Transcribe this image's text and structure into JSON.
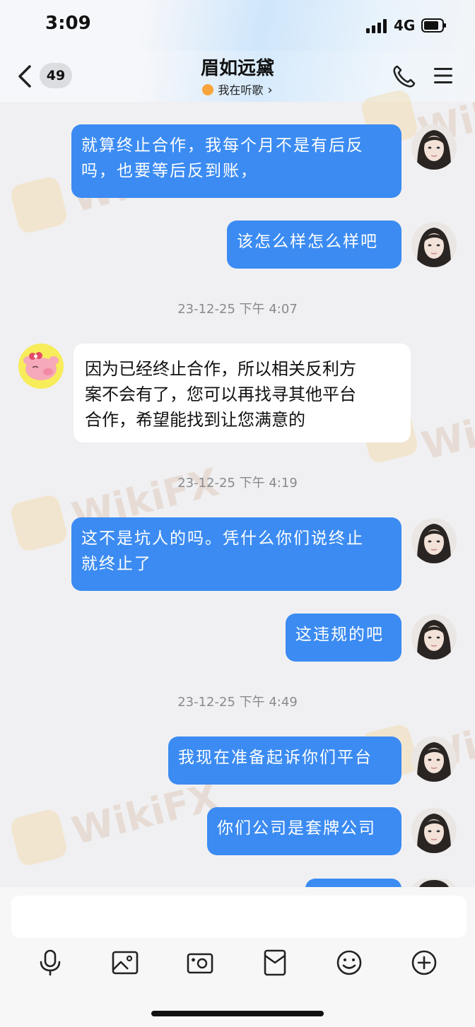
{
  "status": {
    "time": "3:09",
    "network": "4G"
  },
  "header": {
    "unread_count": "49",
    "contact_name": "眉如远黛",
    "contact_status": "我在听歌"
  },
  "messages": [
    {
      "text_line1": "就算终止合作，我每个月不是有后反",
      "text_line2": "吗，也要等后反到账，",
      "sender": "me"
    },
    {
      "text": "该怎么样怎么样吧",
      "sender": "me"
    },
    {
      "timestamp": "23-12-25 下午 4:07"
    },
    {
      "text_line1": "因为已经终止合作，所以相关反利方",
      "text_line2": "案不会有了，您可以再找寻其他平台",
      "text_line3": "合作，希望能找到让您满意的",
      "sender": "other"
    },
    {
      "timestamp": "23-12-25 下午 4:19"
    },
    {
      "text_line1": "这不是坑人的吗。凭什么你们说终止",
      "text_line2": "就终止了",
      "sender": "me"
    },
    {
      "text": "这违规的吧",
      "sender": "me"
    },
    {
      "timestamp": "23-12-25 下午 4:49"
    },
    {
      "text": "我现在准备起诉你们平台",
      "sender": "me"
    },
    {
      "text": "你们公司是套牌公司",
      "sender": "me"
    }
  ],
  "watermark": {
    "text": "WikiFX"
  },
  "composer": {
    "placeholder": ""
  },
  "toolbar": [
    "microphone-icon",
    "image-icon",
    "camera-icon",
    "red-packet-icon",
    "emoji-icon",
    "plus-icon"
  ],
  "colors": {
    "outgoing_bubble": "#3b8bf2",
    "incoming_bubble": "#ffffff",
    "background": "#f0f0f2"
  }
}
